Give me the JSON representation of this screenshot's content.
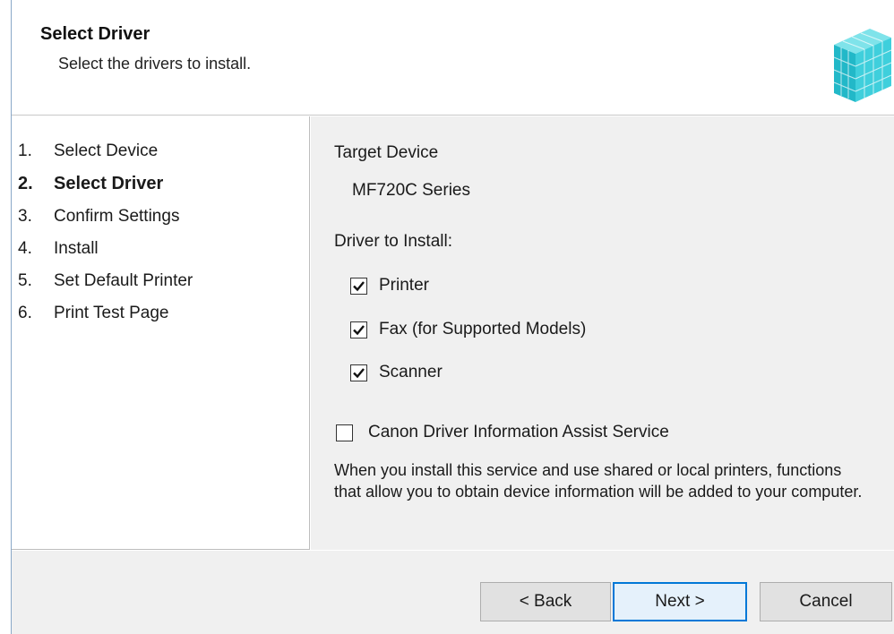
{
  "header": {
    "title": "Select Driver",
    "subtitle": "Select the drivers to install."
  },
  "steps": [
    {
      "num": "1.",
      "label": "Select Device"
    },
    {
      "num": "2.",
      "label": "Select Driver"
    },
    {
      "num": "3.",
      "label": "Confirm Settings"
    },
    {
      "num": "4.",
      "label": "Install"
    },
    {
      "num": "5.",
      "label": "Set Default Printer"
    },
    {
      "num": "6.",
      "label": "Print Test Page"
    }
  ],
  "active_step": 2,
  "options": {
    "target_device_label": "Target Device",
    "target_device_value": "MF720C Series",
    "driver_to_install_label": "Driver to Install:",
    "drivers": [
      {
        "label": "Printer",
        "checked": true
      },
      {
        "label": "Fax (for Supported Models)",
        "checked": true
      },
      {
        "label": "Scanner",
        "checked": true
      }
    ],
    "assist_service": {
      "label": "Canon Driver Information Assist Service",
      "checked": false
    },
    "assist_description": "When you install this service and use shared or local printers, functions that allow you to obtain device information will be added to your computer."
  },
  "buttons": {
    "back": "< Back",
    "next": "Next >",
    "cancel": "Cancel"
  }
}
